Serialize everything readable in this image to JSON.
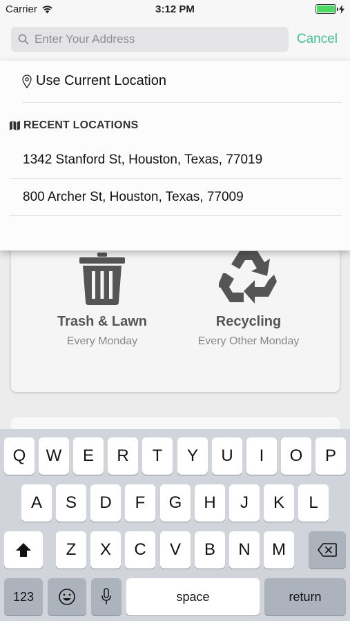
{
  "status_bar": {
    "carrier": "Carrier",
    "time": "3:12 PM",
    "battery_level": 1.0
  },
  "search": {
    "placeholder": "Enter Your Address",
    "value": "",
    "cancel_label": "Cancel",
    "accent_color": "#3fbf8f"
  },
  "dropdown": {
    "current_location_label": "Use Current Location",
    "recent_header": "RECENT LOCATIONS",
    "recent_items": [
      "1342 Stanford St, Houston, Texas, 77019",
      "800 Archer St, Houston, Texas, 77009"
    ]
  },
  "services": [
    {
      "icon": "trash-icon",
      "title": "Trash & Lawn",
      "schedule": "Every Monday"
    },
    {
      "icon": "recycle-icon",
      "title": "Recycling",
      "schedule": "Every Other Monday"
    }
  ],
  "keyboard": {
    "row1": [
      "Q",
      "W",
      "E",
      "R",
      "T",
      "Y",
      "U",
      "I",
      "O",
      "P"
    ],
    "row2": [
      "A",
      "S",
      "D",
      "F",
      "G",
      "H",
      "J",
      "K",
      "L"
    ],
    "row3": [
      "Z",
      "X",
      "C",
      "V",
      "B",
      "N",
      "M"
    ],
    "numbers_label": "123",
    "space_label": "space",
    "return_label": "return"
  }
}
